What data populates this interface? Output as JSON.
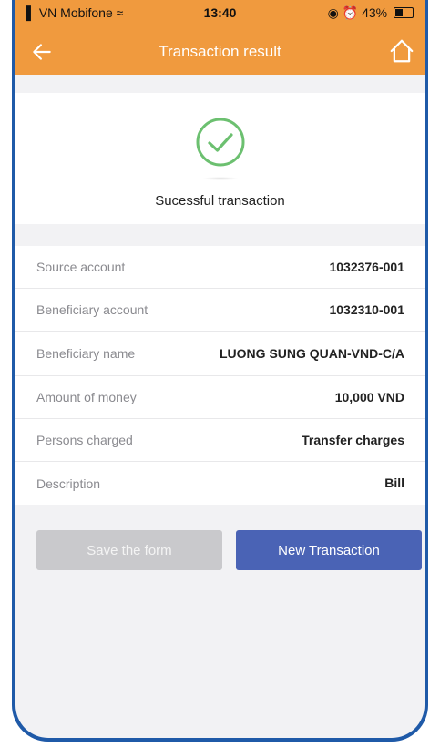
{
  "status_bar": {
    "carrier": "VN Mobifone",
    "time": "13:40",
    "battery": "43%"
  },
  "nav": {
    "title": "Transaction result"
  },
  "result": {
    "message": "Sucessful transaction"
  },
  "details": [
    {
      "label": "Source account",
      "value": "1032376-001"
    },
    {
      "label": "Beneficiary account",
      "value": "1032310-001"
    },
    {
      "label": "Beneficiary name",
      "value": "LUONG SUNG QUAN-VND-C/A"
    },
    {
      "label": "Amount of money",
      "value": "10,000 VND"
    },
    {
      "label": "Persons charged",
      "value": "Transfer charges"
    },
    {
      "label": "Description",
      "value": "Bill"
    }
  ],
  "buttons": {
    "save_label": "Save the form",
    "new_label": "New Transaction"
  },
  "colors": {
    "header": "#f09a3e",
    "success": "#6cc070",
    "primary_button": "#4a63b5",
    "disabled_button": "#c9c9cc"
  }
}
